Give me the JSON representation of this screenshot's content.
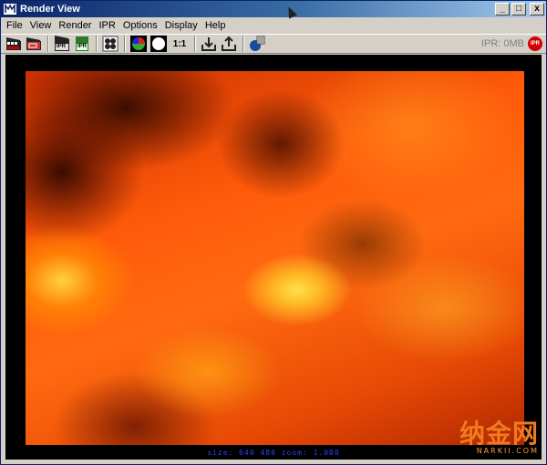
{
  "window": {
    "title": "Render View",
    "icon": "maya-render-view-icon",
    "controls": {
      "minimize": "_",
      "maximize": "□",
      "close": "x"
    }
  },
  "menu": [
    "File",
    "View",
    "Render",
    "IPR",
    "Options",
    "Display",
    "Help"
  ],
  "toolbar": {
    "buttons": [
      {
        "name": "redo-render-icon",
        "label": ""
      },
      {
        "name": "render-region-icon",
        "label": ""
      },
      {
        "name": "ipr-render-icon",
        "label": "IPR"
      },
      {
        "name": "refresh-ipr-icon",
        "label": "IPR"
      },
      {
        "name": "render-settings-icon",
        "label": ""
      },
      {
        "name": "rgb-channels-icon",
        "label": ""
      },
      {
        "name": "alpha-channel-icon",
        "label": ""
      },
      {
        "name": "real-size-icon",
        "label": "1:1"
      },
      {
        "name": "keep-image-icon",
        "label": ""
      },
      {
        "name": "remove-image-icon",
        "label": ""
      },
      {
        "name": "render-globals-icon",
        "label": ""
      }
    ],
    "ipr_status": "IPR: 0MB",
    "ipr_badge": "IPR"
  },
  "render": {
    "status": "size: 640 480 zoom: 1.000"
  },
  "watermark": {
    "text": "纳金网",
    "url": "NARKII.COM"
  },
  "colors": {
    "title_bar": "#0a246a",
    "status_text": "#2244ff",
    "ipr_badge": "#d40000",
    "watermark": "#f07a20"
  }
}
